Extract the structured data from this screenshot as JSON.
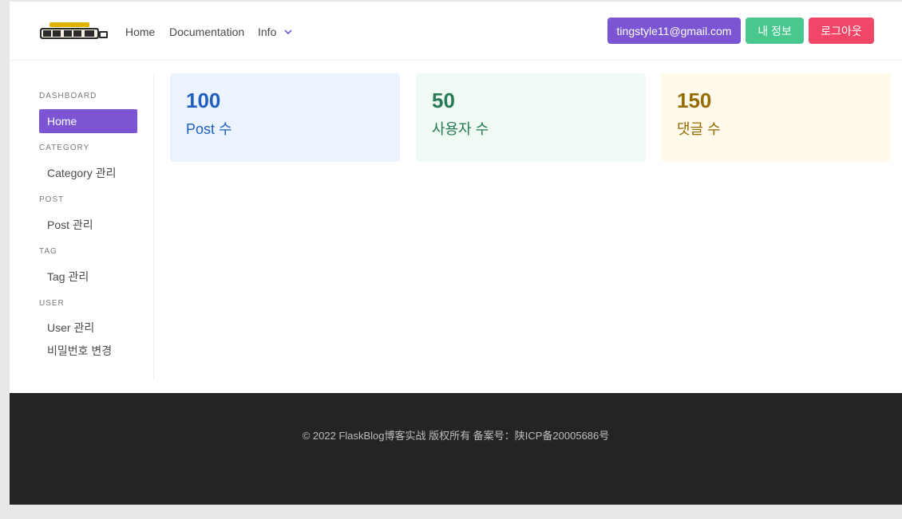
{
  "navbar": {
    "logo_alt": "우아한 형제들",
    "links": [
      {
        "label": "Home"
      },
      {
        "label": "Documentation"
      },
      {
        "label": "Info"
      }
    ],
    "buttons": {
      "email": "tingstyle11@gmail.com",
      "my_info": "내 정보",
      "logout": "로그아웃"
    }
  },
  "sidebar": {
    "sections": [
      {
        "label": "DASHBOARD",
        "items": [
          {
            "label": "Home",
            "active": true
          }
        ]
      },
      {
        "label": "CATEGORY",
        "items": [
          {
            "label": "Category 관리"
          }
        ]
      },
      {
        "label": "POST",
        "items": [
          {
            "label": "Post 관리"
          }
        ]
      },
      {
        "label": "TAG",
        "items": [
          {
            "label": "Tag 관리"
          }
        ]
      },
      {
        "label": "USER",
        "items": [
          {
            "label": "User 관리"
          },
          {
            "label": "비밀번호 변경"
          }
        ]
      }
    ]
  },
  "stats": [
    {
      "value": "100",
      "label": "Post 수"
    },
    {
      "value": "50",
      "label": "사용자 수"
    },
    {
      "value": "150",
      "label": "댓글 수"
    }
  ],
  "footer": {
    "text": "© 2022 FlaskBlog博客实战 版权所有 备案号：陕ICP备20005686号"
  },
  "colors": {
    "primary": "#7b55d4",
    "success": "#48c78e",
    "danger": "#f14668",
    "footer_bg": "#242424"
  }
}
